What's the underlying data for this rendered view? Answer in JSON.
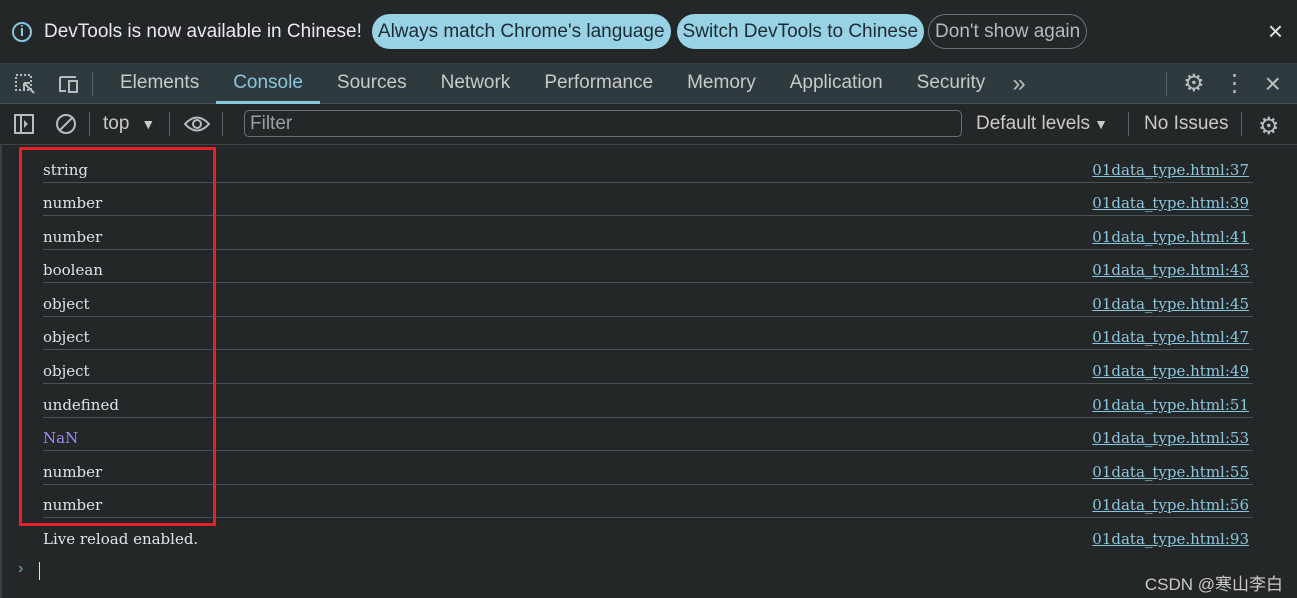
{
  "infobar": {
    "message": "DevTools is now available in Chinese!",
    "buttons": [
      "Always match Chrome's language",
      "Switch DevTools to Chinese",
      "Don't show again"
    ],
    "close_icon": "×"
  },
  "tabbar": {
    "tabs": [
      "Elements",
      "Console",
      "Sources",
      "Network",
      "Performance",
      "Memory",
      "Application",
      "Security"
    ],
    "active_tab": "Console",
    "more_icon": "»",
    "settings_icon": "⚙",
    "menu_icon": "⋮",
    "close_icon": "×"
  },
  "toolbar": {
    "context": "top",
    "filter_placeholder": "Filter",
    "levels": "Default levels",
    "issues": "No Issues"
  },
  "console": {
    "messages": [
      {
        "text": "string",
        "source": "01data_type.html:37"
      },
      {
        "text": "number",
        "source": "01data_type.html:39"
      },
      {
        "text": "number",
        "source": "01data_type.html:41"
      },
      {
        "text": "boolean",
        "source": "01data_type.html:43"
      },
      {
        "text": "object",
        "source": "01data_type.html:45"
      },
      {
        "text": "object",
        "source": "01data_type.html:47"
      },
      {
        "text": "object",
        "source": "01data_type.html:49"
      },
      {
        "text": "undefined",
        "source": "01data_type.html:51"
      },
      {
        "text": "NaN",
        "source": "01data_type.html:53"
      },
      {
        "text": "number",
        "source": "01data_type.html:55"
      },
      {
        "text": "number",
        "source": "01data_type.html:56"
      },
      {
        "text": "Live reload enabled.",
        "source": "01data_type.html:93"
      }
    ],
    "prompt": "›"
  },
  "colors": {
    "accent": "#8ac6dd",
    "nan": "#9a8cf5",
    "highlight": "#e8202a"
  },
  "watermark": "CSDN @寒山李白"
}
